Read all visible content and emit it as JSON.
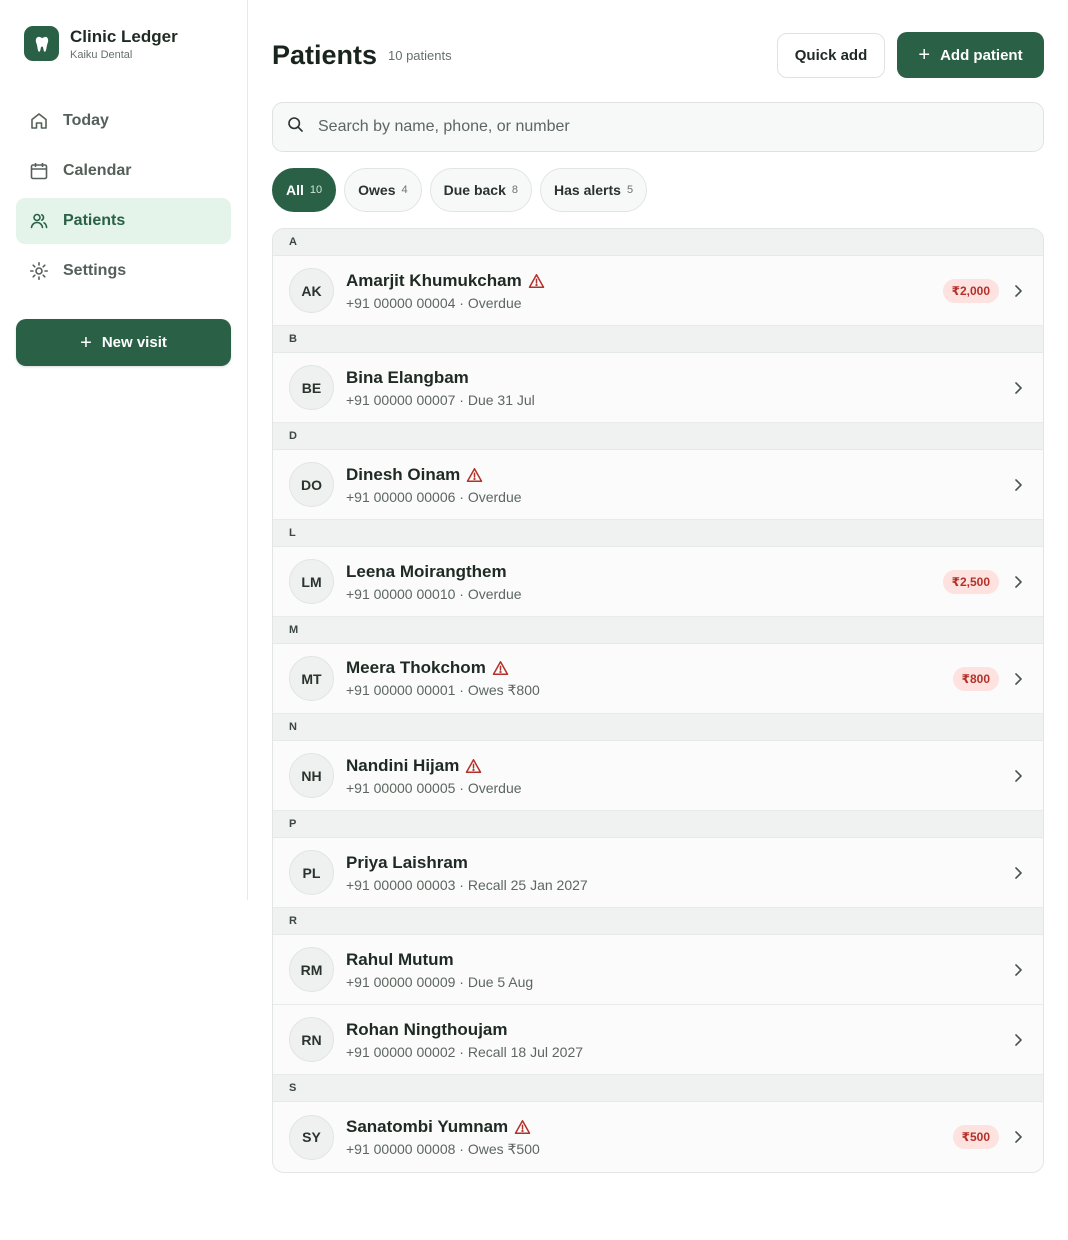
{
  "brand": {
    "title": "Clinic Ledger",
    "subtitle": "Kaiku Dental",
    "logo_icon": "tooth-icon"
  },
  "nav": {
    "items": [
      {
        "label": "Today",
        "icon": "home-icon",
        "active": false
      },
      {
        "label": "Calendar",
        "icon": "calendar-icon",
        "active": false
      },
      {
        "label": "Patients",
        "icon": "users-icon",
        "active": true
      },
      {
        "label": "Settings",
        "icon": "gear-icon",
        "active": false
      }
    ],
    "new_visit_label": "New visit"
  },
  "header": {
    "title": "Patients",
    "count_text": "10 patients",
    "quick_add_label": "Quick add",
    "add_patient_label": "Add patient"
  },
  "search": {
    "placeholder": "Search by name, phone, or number",
    "value": ""
  },
  "filters": [
    {
      "label": "All",
      "count": "10",
      "active": true
    },
    {
      "label": "Owes",
      "count": "4",
      "active": false
    },
    {
      "label": "Due back",
      "count": "8",
      "active": false
    },
    {
      "label": "Has alerts",
      "count": "5",
      "active": false
    }
  ],
  "groups": [
    {
      "letter": "A",
      "patients": [
        {
          "initials": "AK",
          "name": "Amarjit Khumukcham",
          "alert": true,
          "meta": "+91 00000 00004 · Overdue",
          "balance": "₹2,000"
        }
      ]
    },
    {
      "letter": "B",
      "patients": [
        {
          "initials": "BE",
          "name": "Bina Elangbam",
          "alert": false,
          "meta": "+91 00000 00007 · Due 31 Jul",
          "balance": ""
        }
      ]
    },
    {
      "letter": "D",
      "patients": [
        {
          "initials": "DO",
          "name": "Dinesh Oinam",
          "alert": true,
          "meta": "+91 00000 00006 · Overdue",
          "balance": ""
        }
      ]
    },
    {
      "letter": "L",
      "patients": [
        {
          "initials": "LM",
          "name": "Leena Moirangthem",
          "alert": false,
          "meta": "+91 00000 00010 · Overdue",
          "balance": "₹2,500"
        }
      ]
    },
    {
      "letter": "M",
      "patients": [
        {
          "initials": "MT",
          "name": "Meera Thokchom",
          "alert": true,
          "meta": "+91 00000 00001 · Owes ₹800",
          "balance": "₹800"
        }
      ]
    },
    {
      "letter": "N",
      "patients": [
        {
          "initials": "NH",
          "name": "Nandini Hijam",
          "alert": true,
          "meta": "+91 00000 00005 · Overdue",
          "balance": ""
        }
      ]
    },
    {
      "letter": "P",
      "patients": [
        {
          "initials": "PL",
          "name": "Priya Laishram",
          "alert": false,
          "meta": "+91 00000 00003 · Recall 25 Jan 2027",
          "balance": ""
        }
      ]
    },
    {
      "letter": "R",
      "patients": [
        {
          "initials": "RM",
          "name": "Rahul Mutum",
          "alert": false,
          "meta": "+91 00000 00009 · Due 5 Aug",
          "balance": ""
        },
        {
          "initials": "RN",
          "name": "Rohan Ningthoujam",
          "alert": false,
          "meta": "+91 00000 00002 · Recall 18 Jul 2027",
          "balance": ""
        }
      ]
    },
    {
      "letter": "S",
      "patients": [
        {
          "initials": "SY",
          "name": "Sanatombi Yumnam",
          "alert": true,
          "meta": "+91 00000 00008 · Owes ₹500",
          "balance": "₹500"
        }
      ]
    }
  ],
  "colors": {
    "primary": "#2a6146",
    "active_nav_bg": "#e4f4ea",
    "alert": "#b3312a",
    "badge_bg": "#fde2df"
  }
}
